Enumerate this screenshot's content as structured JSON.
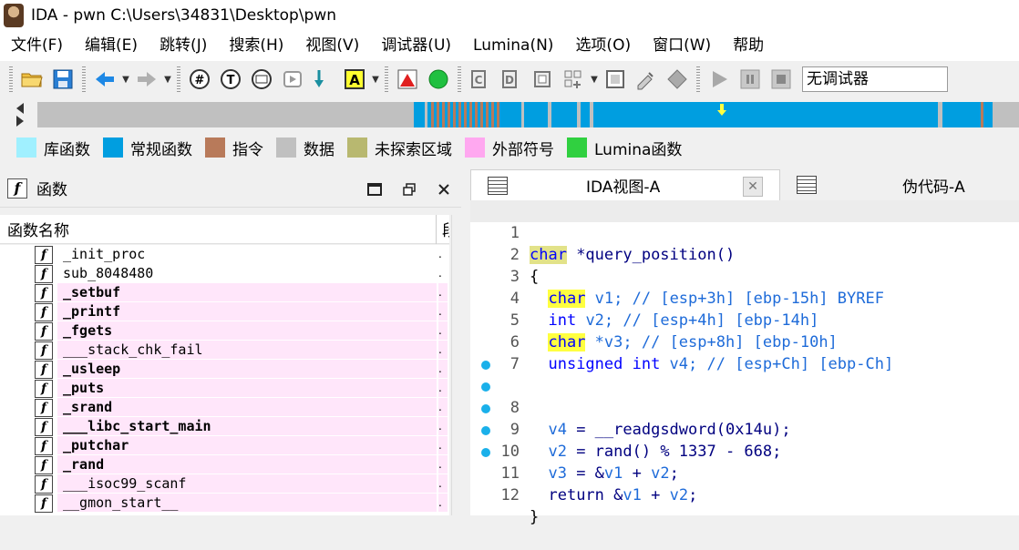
{
  "window": {
    "title": "IDA - pwn C:\\Users\\34831\\Desktop\\pwn"
  },
  "menu": [
    "文件(F)",
    "编辑(E)",
    "跳转(J)",
    "搜索(H)",
    "视图(V)",
    "调试器(U)",
    "Lumina(N)",
    "选项(O)",
    "窗口(W)",
    "帮助"
  ],
  "toolbar": {
    "debugger_value": "无调试器"
  },
  "legend": [
    {
      "label": "库函数",
      "color": "#a0f0ff"
    },
    {
      "label": "常规函数",
      "color": "#009ee0"
    },
    {
      "label": "指令",
      "color": "#b87a5a"
    },
    {
      "label": "数据",
      "color": "#c0c0c0"
    },
    {
      "label": "未探索区域",
      "color": "#b8b870"
    },
    {
      "label": "外部符号",
      "color": "#ffa8f0"
    },
    {
      "label": "Lumina函数",
      "color": "#30d040"
    }
  ],
  "functions_pane": {
    "title": "函数",
    "column_name": "函数名称",
    "column_right": "段",
    "rows": [
      {
        "name": "_init_proc",
        "external": false,
        "bold": false
      },
      {
        "name": "sub_8048480",
        "external": false,
        "bold": false
      },
      {
        "name": "_setbuf",
        "external": true,
        "bold": true
      },
      {
        "name": "_printf",
        "external": true,
        "bold": true
      },
      {
        "name": "_fgets",
        "external": true,
        "bold": true
      },
      {
        "name": "___stack_chk_fail",
        "external": true,
        "bold": false
      },
      {
        "name": "_usleep",
        "external": true,
        "bold": true
      },
      {
        "name": "_puts",
        "external": true,
        "bold": true
      },
      {
        "name": "_srand",
        "external": true,
        "bold": true
      },
      {
        "name": "___libc_start_main",
        "external": true,
        "bold": true
      },
      {
        "name": "_putchar",
        "external": true,
        "bold": true
      },
      {
        "name": "_rand",
        "external": true,
        "bold": true
      },
      {
        "name": "___isoc99_scanf",
        "external": true,
        "bold": false
      },
      {
        "name": "__gmon_start__",
        "external": true,
        "bold": false
      }
    ]
  },
  "tabs": {
    "ida_view": "IDA视图-A",
    "pseudocode": "伪代码-A",
    "close_glyph": "✕"
  },
  "code": {
    "line_numbers": [
      "1",
      "2",
      "3",
      "4",
      "5",
      "6",
      "7",
      "8",
      "9",
      "10",
      "11",
      "12"
    ],
    "l1_type": "char",
    "l1_rest": " *query_position()",
    "l2": "{",
    "l3_type": "char",
    "l3_var": " v1",
    "l3_cmt": "; // [esp+3h] [ebp-15h] BYREF",
    "l4_type": "int",
    "l4_var": " v2",
    "l4_cmt": "; // [esp+4h] [ebp-14h]",
    "l5_type": "char",
    "l5_var": " *v3",
    "l5_cmt": "; // [esp+8h] [ebp-10h]",
    "l6_type": "unsigned int",
    "l6_var": " v4",
    "l6_cmt": "; // [esp+Ch] [ebp-Ch]",
    "l8_var": "v4",
    "l8_rest": " = __readgsdword(0x14u);",
    "l9_var": "v2",
    "l9_rest": " = rand() % 1337 - 668;",
    "l10_var": "v3",
    "l10_a": " = &",
    "l10_v1": "v1",
    "l10_b": " + ",
    "l10_v2": "v2",
    "l10_c": ";",
    "l11_kw": "return",
    "l11_a": " &",
    "l11_v1": "v1",
    "l11_b": " + ",
    "l11_v2": "v2",
    "l11_c": ";",
    "l12": "}"
  }
}
